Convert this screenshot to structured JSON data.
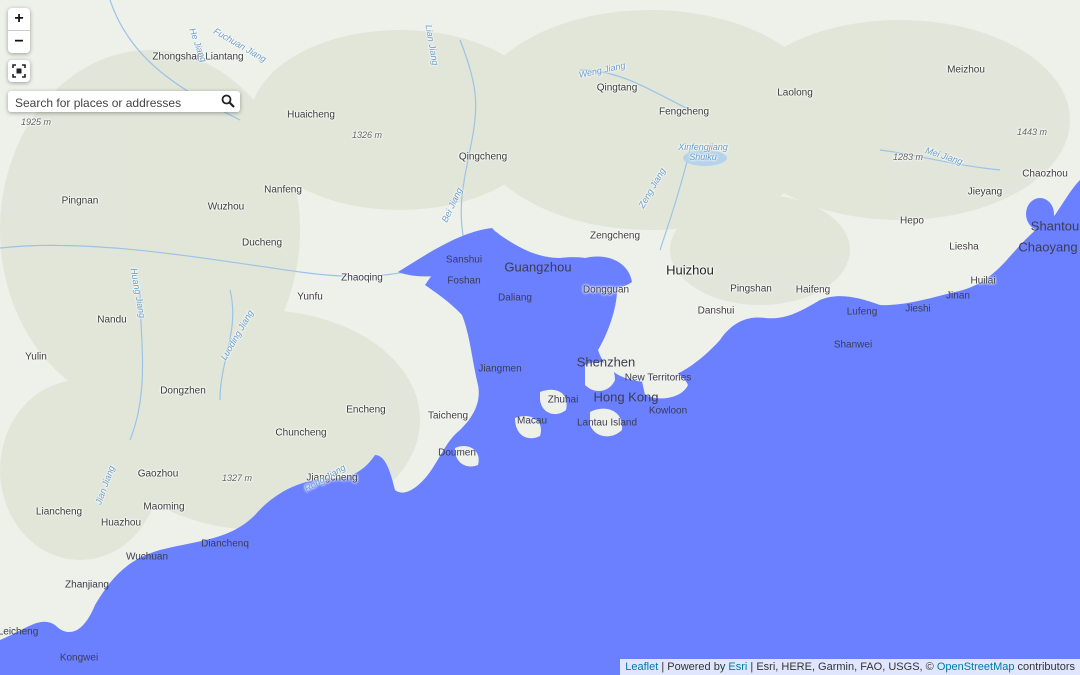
{
  "colors": {
    "land": "#eef0ea",
    "relief": "#dfe4d6",
    "flood": "#6a80ff",
    "river": "#9cc3e6",
    "link": "#0078a8"
  },
  "controls": {
    "zoom_in": "+",
    "zoom_out": "−",
    "fullscreen_icon": "fullscreen-icon",
    "search_placeholder": "Search for places or addresses",
    "search_icon": "search-icon"
  },
  "places": [
    {
      "name": "Zhongshan Liantang"
    },
    {
      "name": "Huaicheng"
    },
    {
      "name": "Qingtang"
    },
    {
      "name": "Fengcheng"
    },
    {
      "name": "Laolong"
    },
    {
      "name": "Meizhou"
    },
    {
      "name": "Qingcheng"
    },
    {
      "name": "Pingnan"
    },
    {
      "name": "Wuzhou"
    },
    {
      "name": "Nanfeng"
    },
    {
      "name": "Jieyang"
    },
    {
      "name": "Chaozhou"
    },
    {
      "name": "Ducheng"
    },
    {
      "name": "Hepo"
    },
    {
      "name": "Zengcheng"
    },
    {
      "name": "Shantou"
    },
    {
      "name": "Chaoyang"
    },
    {
      "name": "Liesha"
    },
    {
      "name": "Sanshui"
    },
    {
      "name": "Guangzhou"
    },
    {
      "name": "Zhaoqing"
    },
    {
      "name": "Huizhou"
    },
    {
      "name": "Foshan"
    },
    {
      "name": "Huilai"
    },
    {
      "name": "Yunfu"
    },
    {
      "name": "Dongguan"
    },
    {
      "name": "Daliang"
    },
    {
      "name": "Pingshan"
    },
    {
      "name": "Haifeng"
    },
    {
      "name": "Jinan"
    },
    {
      "name": "Danshui"
    },
    {
      "name": "Nandu"
    },
    {
      "name": "Jieshi"
    },
    {
      "name": "Lufeng"
    },
    {
      "name": "Shanwei"
    },
    {
      "name": "Yulin"
    },
    {
      "name": "Shenzhen"
    },
    {
      "name": "Jiangmen"
    },
    {
      "name": "New Territories"
    },
    {
      "name": "Dongzhen"
    },
    {
      "name": "Hong Kong"
    },
    {
      "name": "Zhuhai"
    },
    {
      "name": "Encheng"
    },
    {
      "name": "Kowloon"
    },
    {
      "name": "Taicheng"
    },
    {
      "name": "Lantau Island"
    },
    {
      "name": "Macau"
    },
    {
      "name": "Chuncheng"
    },
    {
      "name": "Doumen"
    },
    {
      "name": "Gaozhou"
    },
    {
      "name": "Jiangcheng"
    },
    {
      "name": "Maoming"
    },
    {
      "name": "Liancheng"
    },
    {
      "name": "Huazhou"
    },
    {
      "name": "Dianchenq"
    },
    {
      "name": "Wuchuan"
    },
    {
      "name": "Zhanjiang"
    },
    {
      "name": "Leicheng"
    },
    {
      "name": "Kongwei"
    }
  ],
  "peaks": [
    "1326 m",
    "1925 m",
    "1443 m",
    "1283 m",
    "1327 m"
  ],
  "water_labels": [
    "Fuchuan Jiang",
    "Lian Jiang",
    "Weng Jiang",
    "Xinfengjiang Shuiku",
    "Zeng Jiang",
    "Bei Jiang",
    "Huang Jiang",
    "Luoding Jiang",
    "Rong Jiang",
    "Jian Jiang",
    "He Jiang",
    "Mei Jiang"
  ],
  "attribution": {
    "leaflet": "Leaflet",
    "powered_by": " | Powered by ",
    "esri": "Esri",
    "sources": " | Esri, HERE, Garmin, FAO, USGS, © ",
    "osm": "OpenStreetMap",
    "contributors": " contributors"
  }
}
